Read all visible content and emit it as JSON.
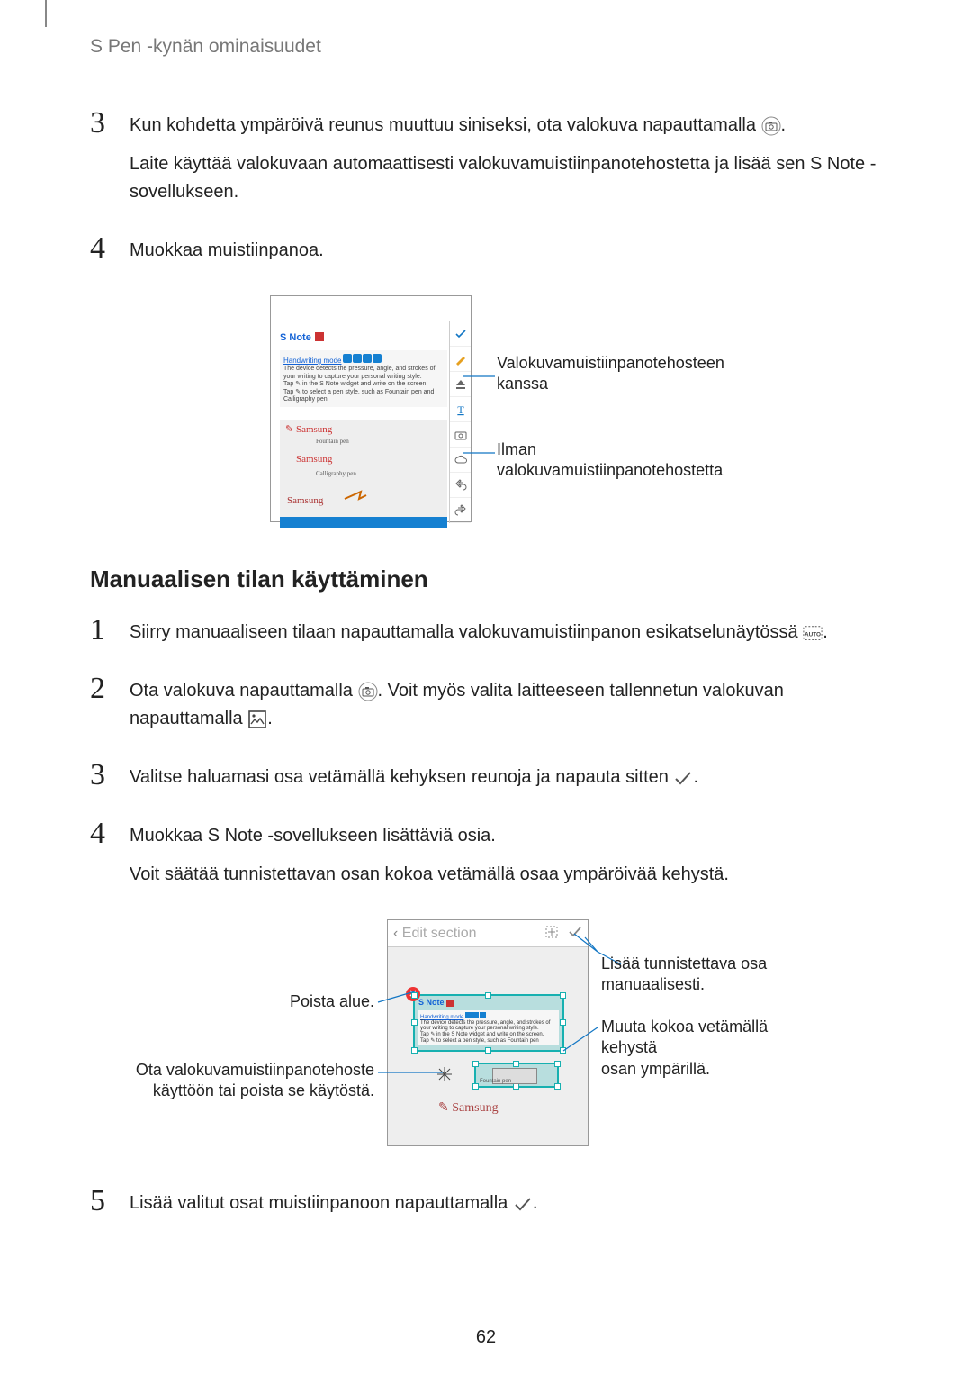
{
  "header": "S Pen -kynän ominaisuudet",
  "steps_a": [
    {
      "num": "3",
      "lines": [
        "Kun kohdetta ympäröivä reunus muuttuu siniseksi, ota valokuva napauttamalla ",
        "Laite käyttää valokuvaan automaattisesti valokuvamuistiinpanotehostetta ja lisää sen S Note -sovellukseen."
      ]
    },
    {
      "num": "4",
      "lines": [
        "Muokkaa muistiinpanoa."
      ]
    }
  ],
  "fig1": {
    "snote": "S Note",
    "hw_title": "Handwriting mode",
    "hw_text1": "The device detects the pressure, angle, and strokes of your writing to capture your personal writing style.",
    "hw_text2": "Tap ✎ in the S Note widget and write on the screen.",
    "hw_text3": "Tap ✎ to select a pen style, such as Fountain pen and Calligraphy pen.",
    "callout_top": "Valokuvamuistiinpanotehosteen kanssa",
    "callout_bottom": "Ilman valokuvamuistiinpanotehostetta"
  },
  "section2_title": "Manuaalisen tilan käyttäminen",
  "steps_b": [
    {
      "num": "1",
      "lines": [
        "Siirry manuaaliseen tilaan napauttamalla valokuvamuistiinpanon esikatselunäytössä "
      ]
    },
    {
      "num": "2",
      "lines": [
        "Ota valokuva napauttamalla ",
        ". Voit myös valita laitteeseen tallennetun valokuvan napauttamalla "
      ]
    },
    {
      "num": "3",
      "lines": [
        "Valitse haluamasi osa vetämällä kehyksen reunoja ja napauta sitten "
      ]
    },
    {
      "num": "4",
      "lines": [
        "Muokkaa S Note -sovellukseen lisättäviä osia.",
        "Voit säätää tunnistettavan osan kokoa vetämällä osaa ympäröivää kehystä."
      ]
    }
  ],
  "fig2": {
    "topbar_back": "‹",
    "topbar_title": "Edit section",
    "left1": "Poista alue.",
    "left2a": "Ota valokuvamuistiinpanotehoste",
    "left2b": "käyttöön tai poista se käytöstä.",
    "right1a": "Lisää tunnistettava osa",
    "right1b": "manuaalisesti.",
    "right2a": "Muuta kokoa vetämällä kehystä",
    "right2b": "osan ympärillä."
  },
  "step5": {
    "num": "5",
    "text": "Lisää valitut osat muistiinpanoon napauttamalla "
  },
  "page_num": "62"
}
